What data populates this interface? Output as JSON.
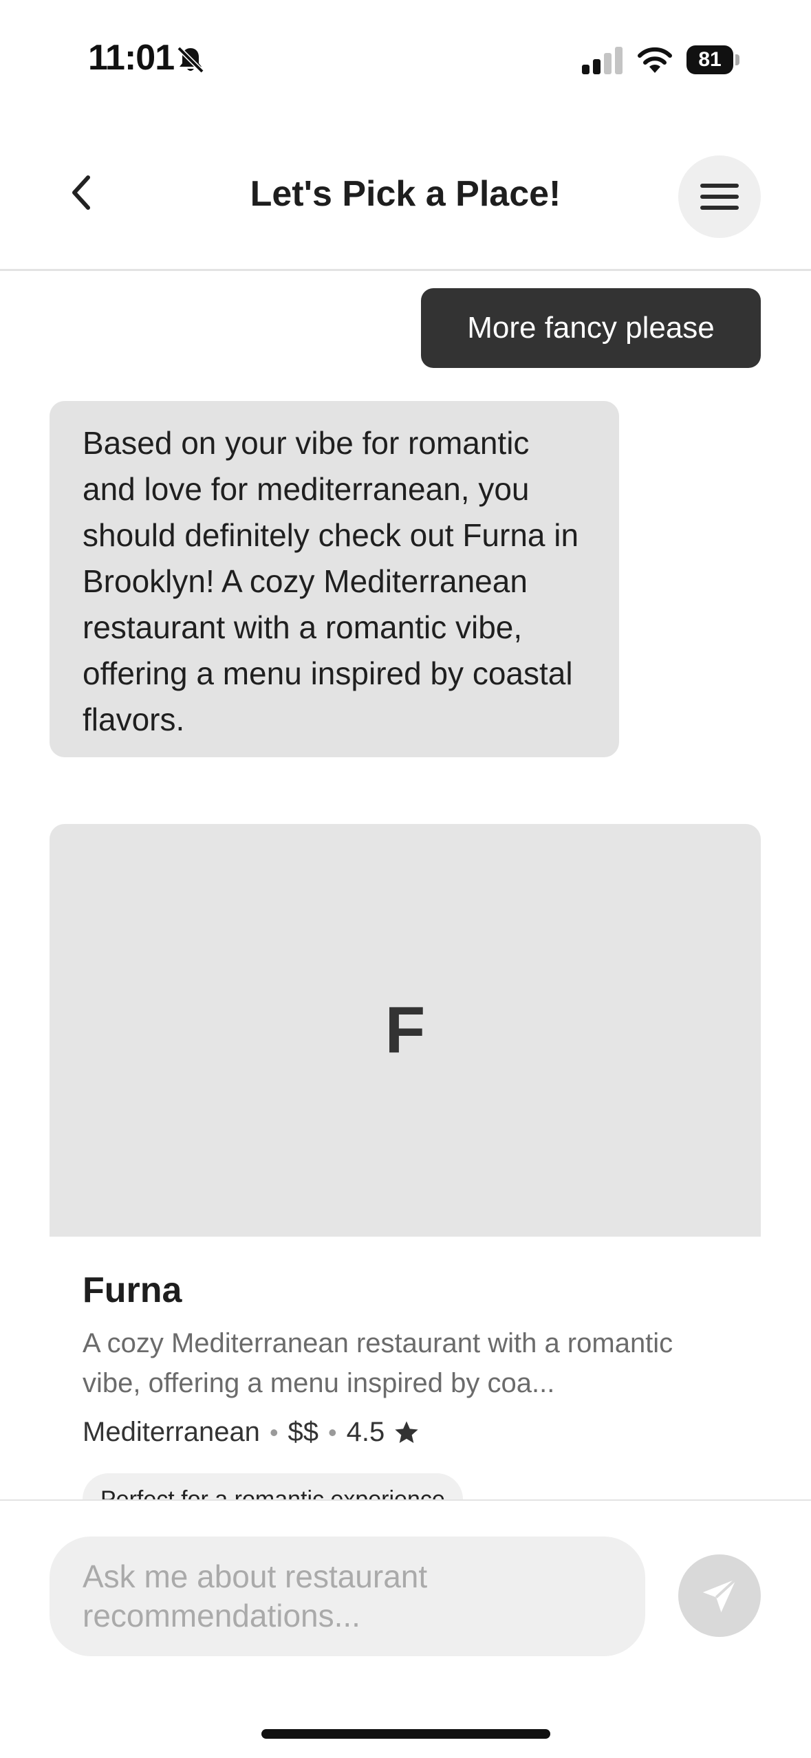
{
  "status_bar": {
    "time": "11:01",
    "battery": "81",
    "icons": [
      "bell-slash-icon",
      "signal-icon",
      "wifi-icon",
      "battery-icon"
    ]
  },
  "header": {
    "title": "Let's Pick a Place!",
    "icons": [
      "chevron-left-icon",
      "menu-icon"
    ]
  },
  "chat": {
    "user_message": "More fancy please",
    "bot_message": "Based on your vibe for romantic and love for mediterranean, you should definitely check out Furna in Brooklyn! A cozy Mediterranean restaurant with a romantic vibe, offering a menu inspired by coastal flavors."
  },
  "restaurant_card": {
    "initial": "F",
    "name": "Furna",
    "description": "A cozy Mediterranean restaurant with a romantic vibe, offering a menu inspired by coa...",
    "cuisine": "Mediterranean",
    "price": "$$",
    "rating": "4.5",
    "separator": "•",
    "tag": "Perfect for a romantic experience"
  },
  "composer": {
    "placeholder": "Ask me about restaurant recommendations...",
    "send_icon": "send-icon"
  },
  "colors": {
    "user_bubble": "#333333",
    "bot_bubble": "#e3e3e3",
    "card_image": "#e5e5e5",
    "input_bg": "#efefef",
    "send_disabled": "#d9d9d9"
  }
}
